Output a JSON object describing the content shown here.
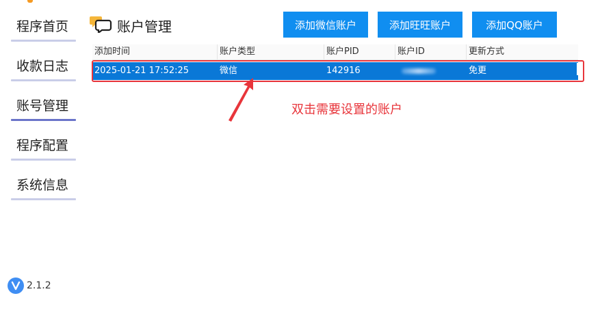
{
  "sidebar": {
    "items": [
      {
        "label": "程序首页",
        "active": false
      },
      {
        "label": "收款日志",
        "active": false
      },
      {
        "label": "账号管理",
        "active": true
      },
      {
        "label": "程序配置",
        "active": false
      },
      {
        "label": "系统信息",
        "active": false
      }
    ],
    "version_icon": "V",
    "version": "2.1.2"
  },
  "header": {
    "icon": "chat-bubbles-icon",
    "title": "账户管理"
  },
  "actions": {
    "add_wechat": "添加微信账户",
    "add_wangwang": "添加旺旺账户",
    "add_qq": "添加QQ账户"
  },
  "table": {
    "columns": [
      "添加时间",
      "账户类型",
      "账户PID",
      "账户ID",
      "更新方式"
    ],
    "rows": [
      {
        "added_time": "2025-01-21 17:52:25",
        "type": "微信",
        "pid": "142916",
        "account_id": "",
        "update_mode": "免更"
      }
    ]
  },
  "annotation": {
    "text": "双击需要设置的账户"
  },
  "colors": {
    "primary": "#108ef0",
    "selected_row": "#0a78d7",
    "highlight": "#e8353b",
    "nav_active_underline": "#6a74c9",
    "accent_orange": "#f59a23"
  }
}
